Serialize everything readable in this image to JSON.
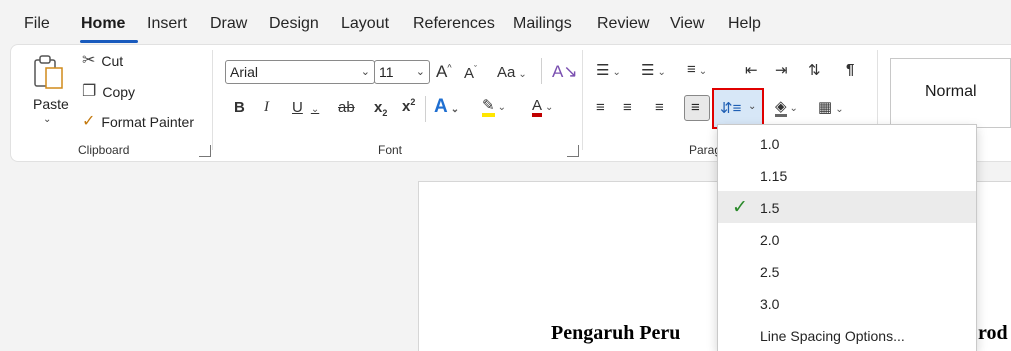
{
  "tabs": [
    {
      "label": "File"
    },
    {
      "label": "Home"
    },
    {
      "label": "Insert"
    },
    {
      "label": "Draw"
    },
    {
      "label": "Design"
    },
    {
      "label": "Layout"
    },
    {
      "label": "References"
    },
    {
      "label": "Mailings"
    },
    {
      "label": "Review"
    },
    {
      "label": "View"
    },
    {
      "label": "Help"
    }
  ],
  "active_tab": "Home",
  "clipboard": {
    "paste_label": "Paste",
    "cut_label": "Cut",
    "copy_label": "Copy",
    "format_painter_label": "Format Painter",
    "group_label": "Clipboard"
  },
  "font": {
    "font_name": "Arial",
    "font_size": "11",
    "grow_glyph": "A",
    "shrink_glyph": "A",
    "change_case_label": "Aa",
    "bold_glyph": "B",
    "italic_glyph": "I",
    "underline_glyph": "U",
    "strike_glyph": "ab",
    "subscript_glyph": "x",
    "superscript_glyph": "x",
    "text_effects_glyph": "A",
    "font_color_glyph": "A",
    "group_label": "Font"
  },
  "paragraph": {
    "group_label": "Parag",
    "selected_line_spacing": "1.5"
  },
  "styles": {
    "normal_label": "Normal"
  },
  "line_spacing_menu": {
    "options": [
      "1.0",
      "1.15",
      "1.5",
      "2.0",
      "2.5",
      "3.0"
    ],
    "more_label": "Line Spacing Options..."
  },
  "document": {
    "title_visible": "Pengaruh Peru",
    "title_tail_visible": "rod"
  },
  "colors": {
    "accent": "#185abd",
    "highlight_red": "#e00000",
    "check_green": "#2a8a2a",
    "highlighter_yellow": "#ffe600",
    "font_color_red": "#c00000"
  }
}
